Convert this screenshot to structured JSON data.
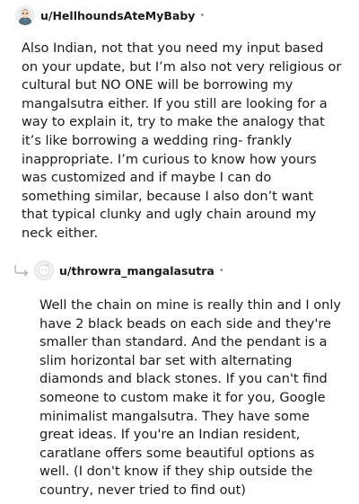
{
  "comments": [
    {
      "username": "u/HellhoundsAteMyBaby",
      "separator": "•",
      "body": "Also Indian, not that you need my input based on your update, but I’m also not very religious or cultural but NO ONE will be borrowing my mangalsutra either. If you still are looking for a way to explain it, try to make the analogy that it’s like borrowing a wedding ring- frankly inappropriate. I’m curious to know how yours was customized and if maybe I can do something similar, because I also don’t want that typical clunky and ugly chain around my neck either."
    },
    {
      "username": "u/throwra_mangalasutra",
      "separator": "•",
      "body": "Well the chain on mine is really thin and I only have 2 black beads on each side and they're smaller than standard. And the pendant is a slim horizontal bar set with alternating diamonds and black stones. If you can't find someone to custom make it for you, Google minimalist mangalsutra. They have some great ideas. If you're an Indian resident, caratlane offers some beautiful options as well. (I don't know if they ship outside the country, never tried to find out)"
    }
  ],
  "icons": {
    "avatar_1": "snoo-avatar-icon",
    "avatar_2": "default-avatar-icon",
    "reply": "reply-arrow-icon"
  },
  "colors": {
    "text": "#1a1a1b",
    "meta": "#878a8c"
  }
}
